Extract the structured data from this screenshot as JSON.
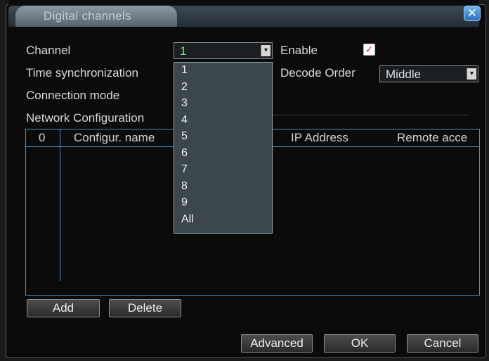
{
  "window": {
    "title": "Digital channels"
  },
  "fields": {
    "channel_label": "Channel",
    "channel_value": "1",
    "enable_label": "Enable",
    "enable_checked": true,
    "time_sync_label": "Time synchronization",
    "decode_order_label": "Decode Order",
    "decode_order_value": "Middle",
    "connection_mode_label": "Connection mode",
    "network_config_label": "Network Configuration"
  },
  "dropdown": {
    "items": [
      "1",
      "2",
      "3",
      "4",
      "5",
      "6",
      "7",
      "8",
      "9",
      "All"
    ]
  },
  "table": {
    "columns": [
      "0",
      "Configur. name",
      "IP Address",
      "Remote acce"
    ]
  },
  "buttons": {
    "add": "Add",
    "delete": "Delete",
    "advanced": "Advanced",
    "ok": "OK",
    "cancel": "Cancel"
  },
  "colors": {
    "accent_blue": "#4b8fc4",
    "close_blue": "#2d6fb6",
    "dropdown_bg": "#3b474d"
  }
}
